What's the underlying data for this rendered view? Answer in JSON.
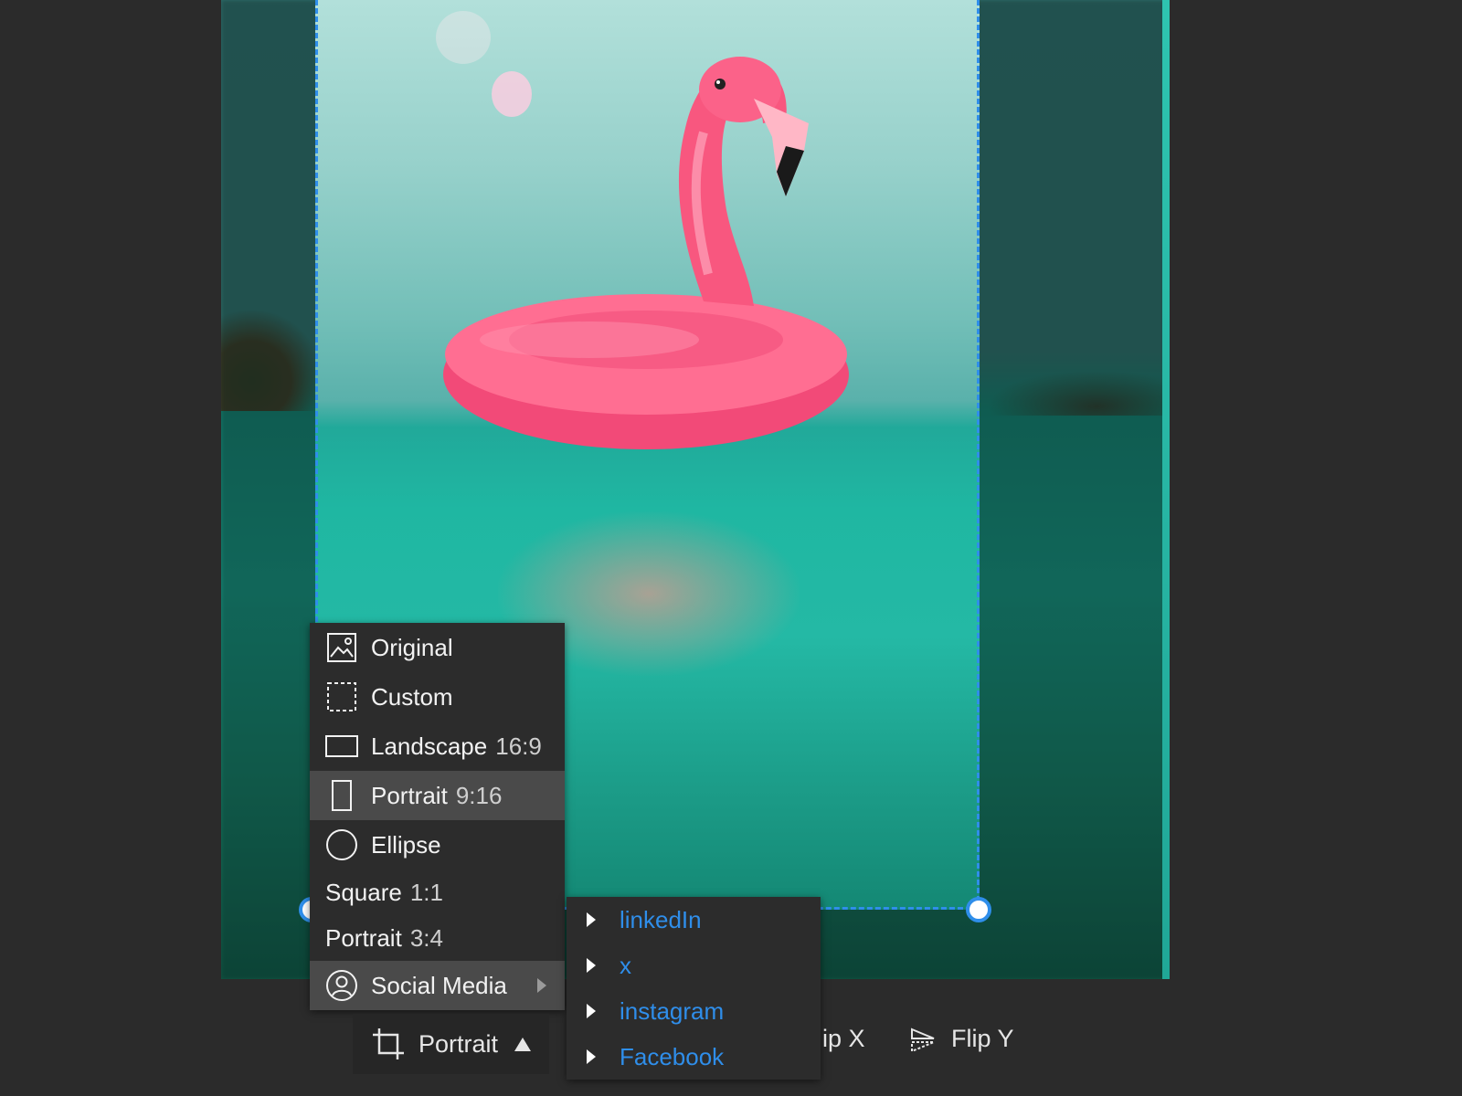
{
  "crop_menu": {
    "items": [
      {
        "label": "Original",
        "ratio": "",
        "icon": "image-icon",
        "state": "normal"
      },
      {
        "label": "Custom",
        "ratio": "",
        "icon": "dashed-rect-icon",
        "state": "normal"
      },
      {
        "label": "Landscape",
        "ratio": "16:9",
        "icon": "landscape-rect-icon",
        "state": "normal"
      },
      {
        "label": "Portrait",
        "ratio": "9:16",
        "icon": "portrait-rect-icon",
        "state": "selected"
      },
      {
        "label": "Ellipse",
        "ratio": "",
        "icon": "circle-icon",
        "state": "normal"
      },
      {
        "label": "Square",
        "ratio": "1:1",
        "icon": "",
        "state": "normal"
      },
      {
        "label": "Portrait",
        "ratio": "3:4",
        "icon": "",
        "state": "normal"
      },
      {
        "label": "Social Media",
        "ratio": "",
        "icon": "user-circle-icon",
        "state": "hover",
        "has_submenu": true
      }
    ]
  },
  "social_submenu": {
    "items": [
      {
        "label": "linkedIn"
      },
      {
        "label": "x"
      },
      {
        "label": "instagram"
      },
      {
        "label": "Facebook"
      }
    ]
  },
  "toolbar": {
    "crop_label": "Portrait",
    "crop_icon": "crop-icon",
    "flip_x_label": "ip X",
    "flip_y_label": "Flip Y",
    "flip_y_icon": "flip-vertical-icon"
  },
  "colors": {
    "accent": "#2f8eea",
    "menu_bg": "#2c2c2c",
    "menu_selected": "#4a4a4a",
    "page_bg": "#2b2b2b"
  }
}
